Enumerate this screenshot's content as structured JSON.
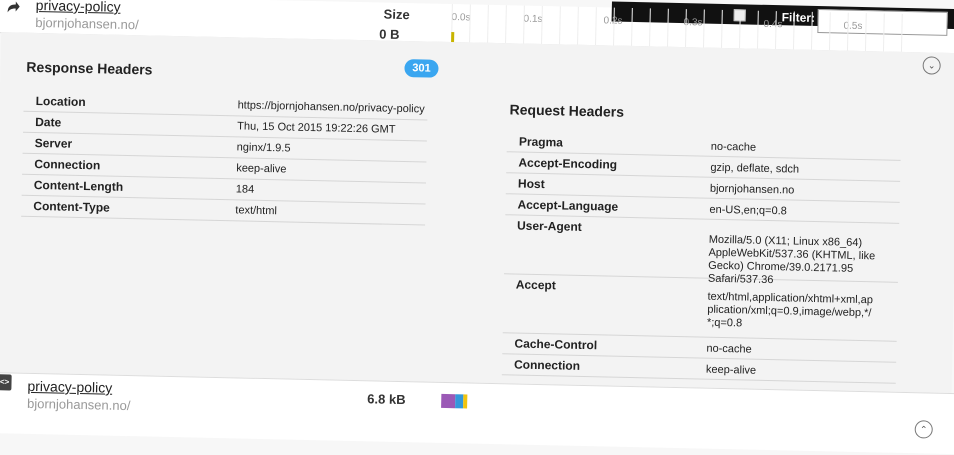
{
  "top_row": {
    "name": "privacy-policy",
    "host": "bjornjohansen.no/",
    "size": "0 B",
    "size_header": "Size",
    "filter_label": "Filter:"
  },
  "timeline_ticks": [
    "0.0s",
    "0.1s",
    "0.2s",
    "0.3s",
    "0.4s",
    "0.5s"
  ],
  "status_badge": "301",
  "response_headers": {
    "title": "Response Headers",
    "rows": [
      {
        "name": "Location",
        "value": "https://bjornjohansen.no/privacy-policy"
      },
      {
        "name": "Date",
        "value": "Thu, 15 Oct 2015 19:22:26 GMT"
      },
      {
        "name": "Server",
        "value": "nginx/1.9.5"
      },
      {
        "name": "Connection",
        "value": "keep-alive"
      },
      {
        "name": "Content-Length",
        "value": "184"
      },
      {
        "name": "Content-Type",
        "value": "text/html"
      }
    ]
  },
  "request_headers": {
    "title": "Request Headers",
    "rows": [
      {
        "name": "Pragma",
        "value": "no-cache"
      },
      {
        "name": "Accept-Encoding",
        "value": "gzip, deflate, sdch"
      },
      {
        "name": "Host",
        "value": "bjornjohansen.no"
      },
      {
        "name": "Accept-Language",
        "value": "en-US,en;q=0.8"
      },
      {
        "name": "User-Agent",
        "value": "Mozilla/5.0 (X11; Linux x86_64) AppleWebKit/537.36 (KHTML, like Gecko) Chrome/39.0.2171.95 Safari/537.36"
      },
      {
        "name": "Accept",
        "value": "text/html,application/xhtml+xml,application/xml;q=0.9,image/webp,*/*;q=0.8"
      },
      {
        "name": "Cache-Control",
        "value": "no-cache"
      },
      {
        "name": "Connection",
        "value": "keep-alive"
      }
    ]
  },
  "bottom_row": {
    "name": "privacy-policy",
    "host": "bjornjohansen.no/",
    "size": "6.8 kB"
  },
  "colors": {
    "badge": "#3aa6f0",
    "wf_purple": "#9b59b6",
    "wf_blue": "#3498db",
    "wf_yellow": "#f1c40f"
  }
}
